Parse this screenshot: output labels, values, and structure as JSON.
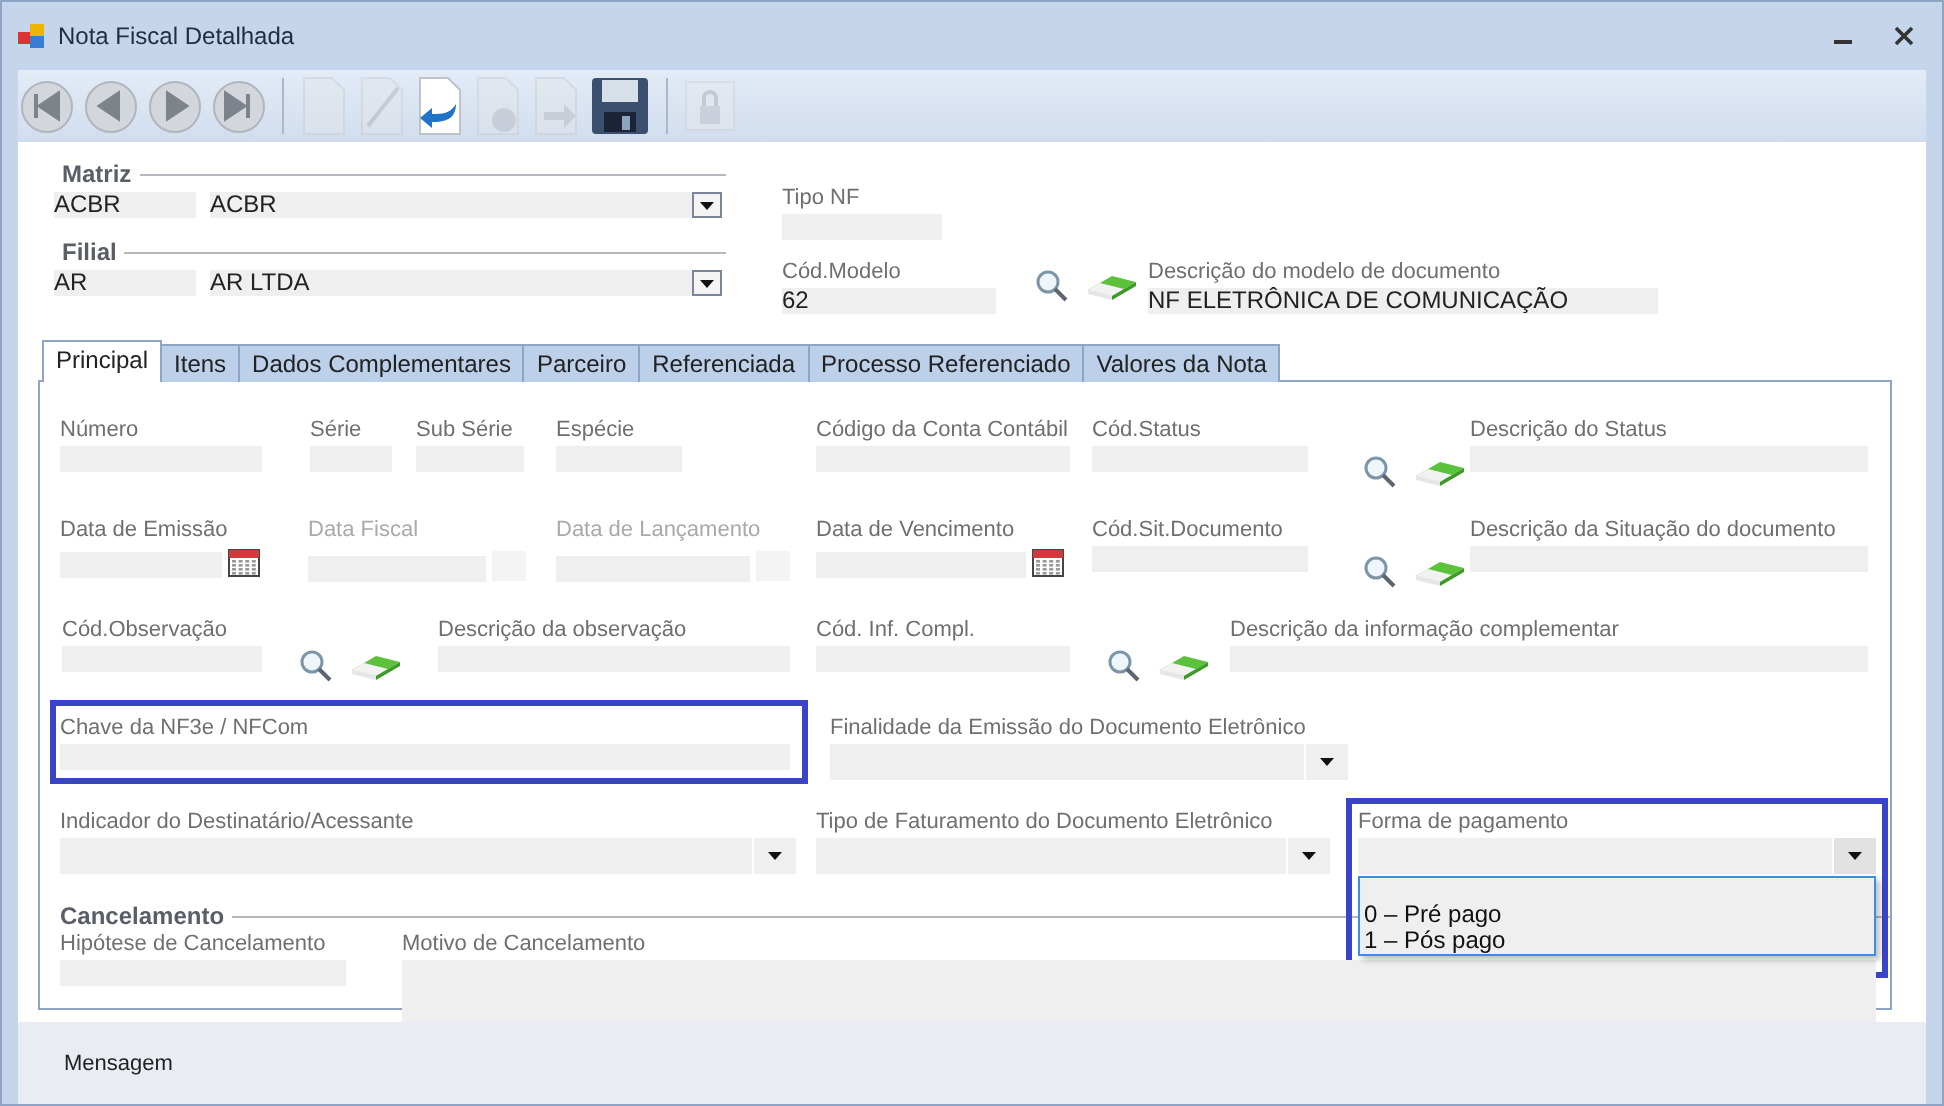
{
  "window": {
    "title": "Nota Fiscal Detalhada"
  },
  "toolbar": [
    {
      "kind": "first",
      "disabled": false
    },
    {
      "kind": "previous",
      "disabled": false
    },
    {
      "kind": "next",
      "disabled": false
    },
    {
      "kind": "last",
      "disabled": false
    },
    {
      "kind": "separator"
    },
    {
      "kind": "new",
      "disabled": true
    },
    {
      "kind": "edit",
      "disabled": true
    },
    {
      "kind": "undo",
      "disabled": false
    },
    {
      "kind": "delete",
      "disabled": true
    },
    {
      "kind": "forward",
      "disabled": true
    },
    {
      "kind": "save",
      "disabled": false
    },
    {
      "kind": "separator"
    },
    {
      "kind": "lock",
      "disabled": true
    }
  ],
  "matriz": {
    "title": "Matriz",
    "code": "ACBR",
    "name": "ACBR"
  },
  "filial": {
    "title": "Filial",
    "code": "AR",
    "name": "AR LTDA"
  },
  "tipo_nf": {
    "label": "Tipo NF"
  },
  "modelo": {
    "label": "Cód.Modelo",
    "value": "62",
    "description_label": "Descrição do modelo de documento",
    "description": "NF ELETRÔNICA DE COMUNICAÇÃO"
  },
  "tabs": [
    {
      "label": "Principal",
      "selected": true
    },
    {
      "label": "Itens",
      "selected": false
    },
    {
      "label": "Dados Complementares",
      "selected": false
    },
    {
      "label": "Parceiro",
      "selected": false
    },
    {
      "label": "Referenciada",
      "selected": false
    },
    {
      "label": "Processo Referenciado",
      "selected": false
    },
    {
      "label": "Valores da Nota",
      "selected": false
    }
  ],
  "rows": [
    [
      {
        "kind": "text",
        "label": "Número",
        "highlighted": false
      },
      {
        "kind": "text",
        "label": "Série",
        "highlighted": false
      },
      {
        "kind": "text",
        "label": "Sub Série",
        "highlighted": false
      },
      {
        "kind": "text",
        "label": "Espécie",
        "highlighted": false
      },
      {
        "kind": "text",
        "label": "Código da Conta Contábil",
        "highlighted": false
      },
      {
        "kind": "lookup",
        "label": "Cód.Status",
        "highlighted": false
      },
      {
        "kind": "text",
        "label": "Descrição do Status",
        "highlighted": false
      }
    ],
    [
      {
        "kind": "date",
        "label": "Data de Emissão",
        "disabled": false,
        "highlighted": false
      },
      {
        "kind": "date",
        "label": "Data Fiscal",
        "disabled": true,
        "highlighted": false
      },
      {
        "kind": "date",
        "label": "Data de Lançamento",
        "disabled": true,
        "highlighted": false
      },
      {
        "kind": "date",
        "label": "Data de Vencimento",
        "disabled": false,
        "highlighted": false
      },
      {
        "kind": "lookup",
        "label": "Cód.Sit.Documento",
        "highlighted": false
      },
      {
        "kind": "text",
        "label": "Descrição da Situação do documento",
        "highlighted": false
      }
    ],
    [
      {
        "kind": "lookup",
        "label": "Cód.Observação",
        "highlighted": false
      },
      {
        "kind": "text",
        "label": "Descrição da observação",
        "highlighted": false
      },
      {
        "kind": "lookup",
        "label": "Cód. Inf. Compl.",
        "highlighted": false
      },
      {
        "kind": "text",
        "label": "Descrição da informação complementar",
        "highlighted": false
      }
    ],
    [
      {
        "kind": "text",
        "label": "Chave da NF3e / NFCom",
        "highlighted": true
      },
      {
        "kind": "combo",
        "label": "Finalidade da Emissão do Documento Eletrônico",
        "open": false,
        "highlighted": false
      }
    ],
    [
      {
        "kind": "combo",
        "label": "Indicador do Destinatário/Acessante",
        "open": false,
        "highlighted": false
      },
      {
        "kind": "combo",
        "label": "Tipo de Faturamento do Documento Eletrônico",
        "open": false,
        "highlighted": false
      },
      {
        "kind": "combo",
        "label": "Forma de pagamento",
        "open": true,
        "highlighted": true,
        "options": [
          {
            "label": "0 – Pré pago",
            "selected": false
          },
          {
            "label": "1 – Pós pago",
            "selected": false
          }
        ]
      }
    ]
  ],
  "cancelamento": {
    "title": "Cancelamento",
    "fields": [
      {
        "kind": "text",
        "label": "Hipótese de Cancelamento",
        "highlighted": false
      },
      {
        "kind": "memo",
        "label": "Motivo de Cancelamento",
        "highlighted": false
      }
    ]
  },
  "status_bar": {
    "label": "Mensagem"
  }
}
